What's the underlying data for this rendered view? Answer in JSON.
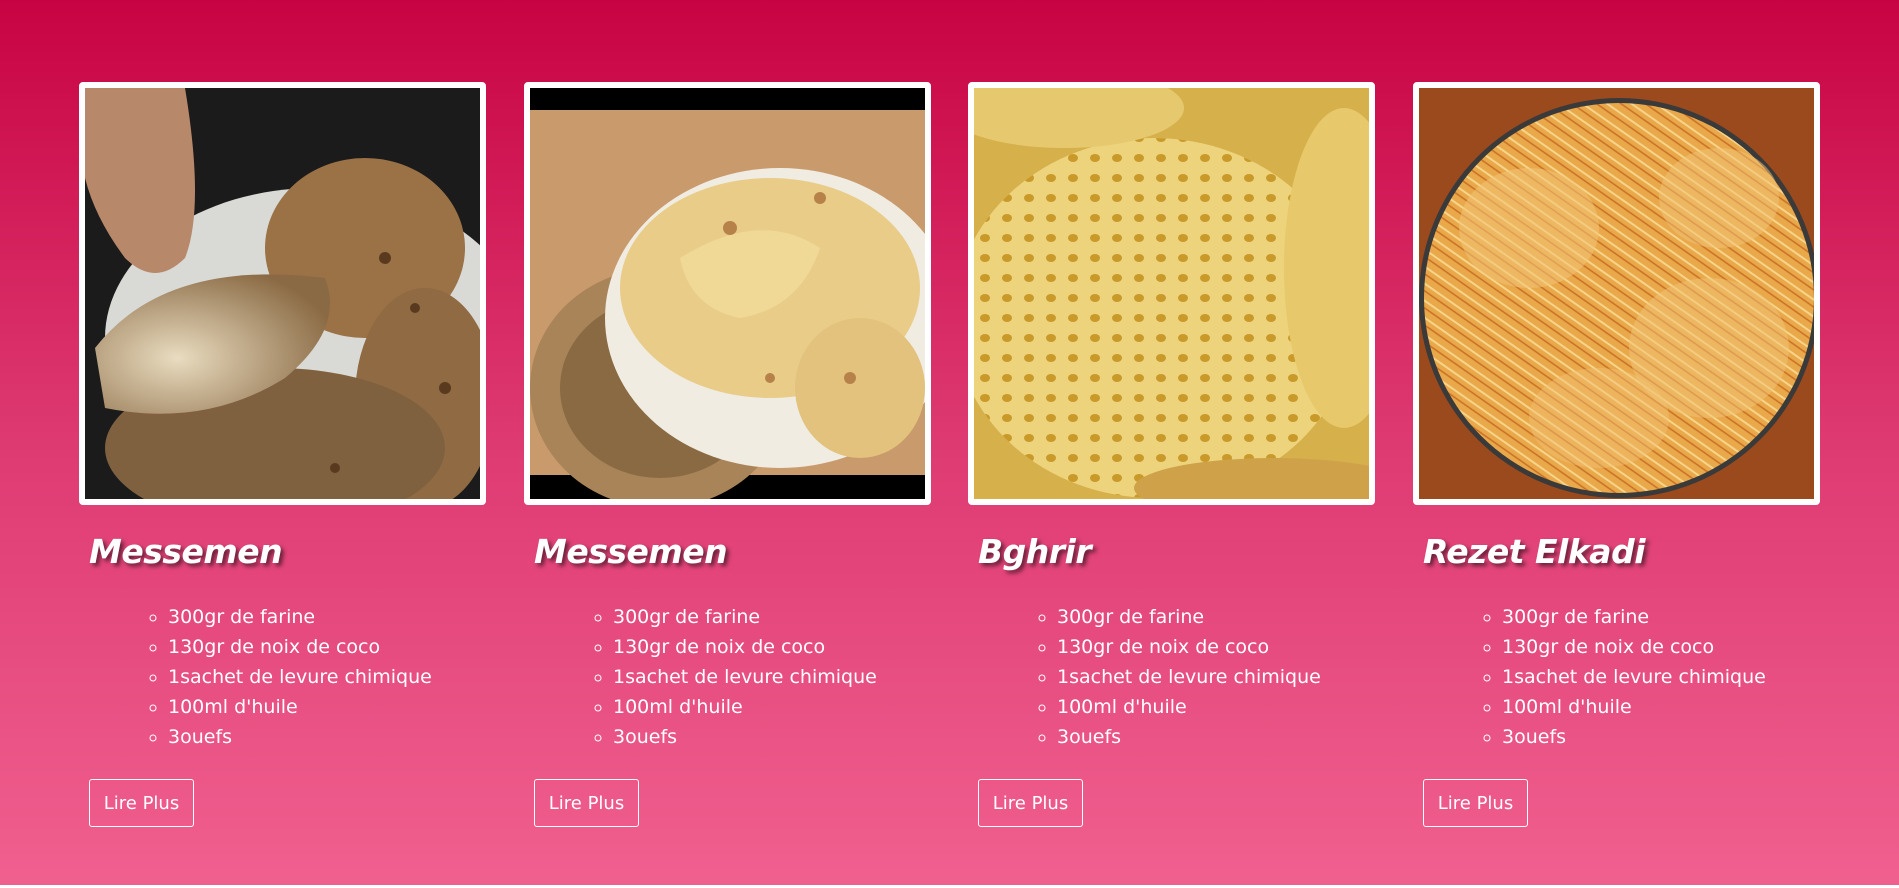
{
  "recipes": [
    {
      "title": "Messemen",
      "image": "messemen-folded-photo",
      "ingredients": [
        "300gr de farine",
        "130gr de noix de coco",
        "1sachet de levure chimique",
        "100ml d'huile",
        "3ouefs"
      ],
      "button_label": "Lire Plus"
    },
    {
      "title": "Messemen",
      "image": "messemen-stack-photo",
      "ingredients": [
        "300gr de farine",
        "130gr de noix de coco",
        "1sachet de levure chimique",
        "100ml d'huile",
        "3ouefs"
      ],
      "button_label": "Lire Plus"
    },
    {
      "title": "Bghrir",
      "image": "bghrir-pancake-photo",
      "ingredients": [
        "300gr de farine",
        "130gr de noix de coco",
        "1sachet de levure chimique",
        "100ml d'huile",
        "3ouefs"
      ],
      "button_label": "Lire Plus"
    },
    {
      "title": "Rezet Elkadi",
      "image": "rezet-elkadi-photo",
      "ingredients": [
        "300gr de farine",
        "130gr de noix de coco",
        "1sachet de levure chimique",
        "100ml d'huile",
        "3ouefs"
      ],
      "button_label": "Lire Plus"
    }
  ],
  "colors": {
    "gradient_top": "#c80343",
    "gradient_bottom": "#f0608f",
    "text": "#ffffff"
  }
}
